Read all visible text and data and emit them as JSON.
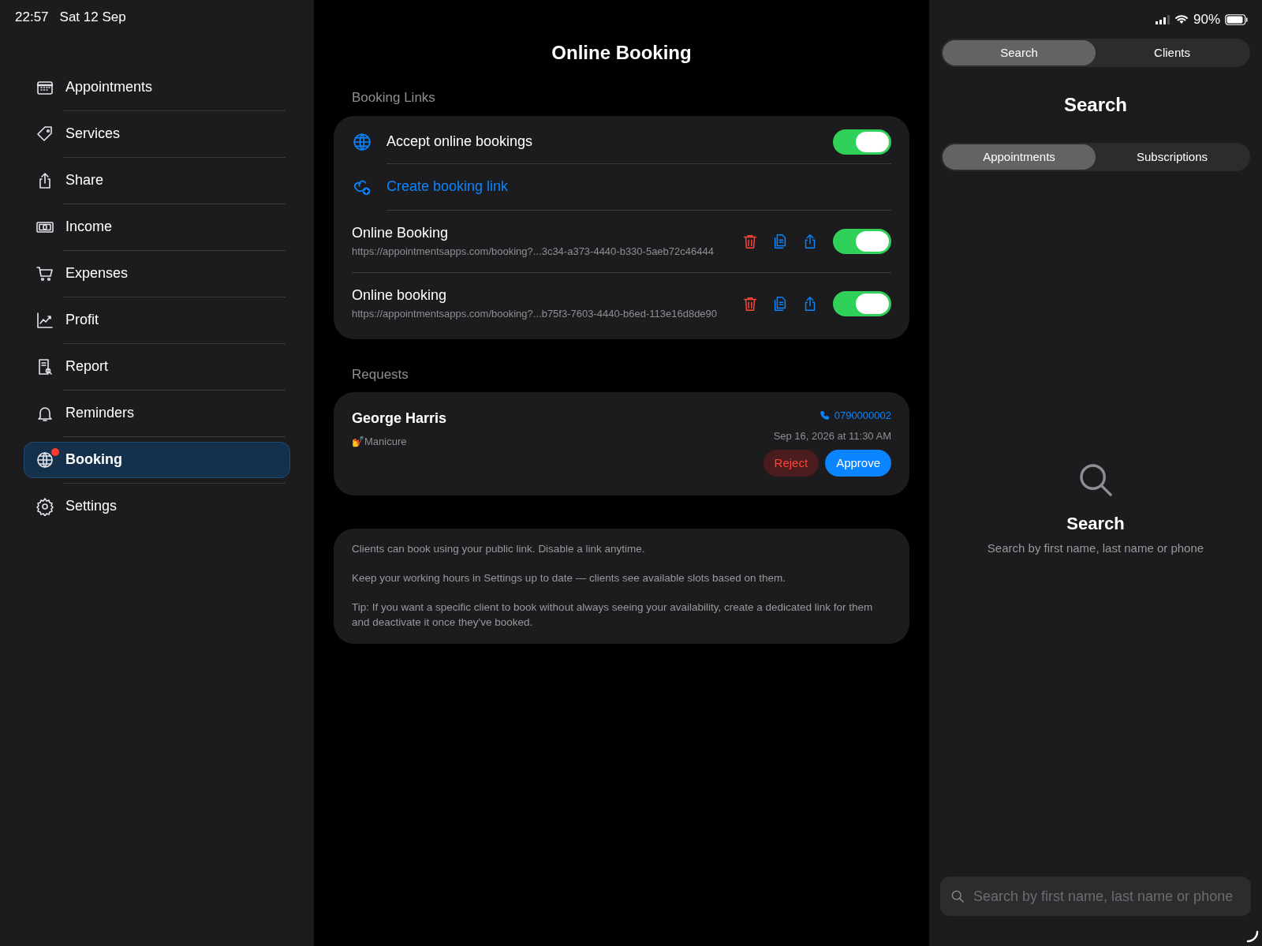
{
  "status_bar": {
    "time": "22:57",
    "date": "Sat 12 Sep",
    "battery": "90%"
  },
  "sidebar": {
    "items": [
      {
        "label": "Appointments",
        "selected": false,
        "badge_dot": false
      },
      {
        "label": "Services",
        "selected": false,
        "badge_dot": false
      },
      {
        "label": "Share",
        "selected": false,
        "badge_dot": false
      },
      {
        "label": "Income",
        "selected": false,
        "badge_dot": false
      },
      {
        "label": "Expenses",
        "selected": false,
        "badge_dot": false
      },
      {
        "label": "Profit",
        "selected": false,
        "badge_dot": false
      },
      {
        "label": "Report",
        "selected": false,
        "badge_dot": false
      },
      {
        "label": "Reminders",
        "selected": false,
        "badge_dot": false
      },
      {
        "label": "Booking",
        "selected": true,
        "badge_dot": true
      },
      {
        "label": "Settings",
        "selected": false,
        "badge_dot": false
      }
    ]
  },
  "main": {
    "title": "Online Booking",
    "booking_links": {
      "header": "Booking Links",
      "accept": {
        "label": "Accept online bookings",
        "on": true
      },
      "create_link": "Create booking link",
      "links": [
        {
          "name": "Online Booking",
          "url": "https://appointmentsapps.com/booking?...3c34-a373-4440-b330-5aeb72c46444",
          "on": true
        },
        {
          "name": "Online booking",
          "url": "https://appointmentsapps.com/booking?...b75f3-7603-4440-b6ed-113e16d8de90",
          "on": true
        }
      ]
    },
    "requests": {
      "header": "Requests",
      "items": [
        {
          "client": "George Harris",
          "service": "💅Manicure",
          "phone": "0790000002",
          "when": "Sep 16, 2026 at 11:30 AM",
          "reject": "Reject",
          "approve": "Approve"
        }
      ]
    },
    "info": [
      "Clients can book using your public link. Disable a link anytime.",
      "Keep your working hours in Settings up to date — clients see available slots based on them.",
      "Tip: If you want a specific client to book without always seeing your availability, create a dedicated link for them and deactivate it once they've booked."
    ]
  },
  "search_panel": {
    "top_tabs": [
      {
        "label": "Search",
        "selected": true
      },
      {
        "label": "Clients",
        "selected": false
      }
    ],
    "title": "Search",
    "scope_tabs": [
      {
        "label": "Appointments",
        "selected": true
      },
      {
        "label": "Subscriptions",
        "selected": false
      }
    ],
    "empty_title": "Search",
    "empty_subtitle": "Search by first name, last name or phone",
    "search_field": {
      "placeholder": "Search by first name, last name or phone"
    }
  }
}
